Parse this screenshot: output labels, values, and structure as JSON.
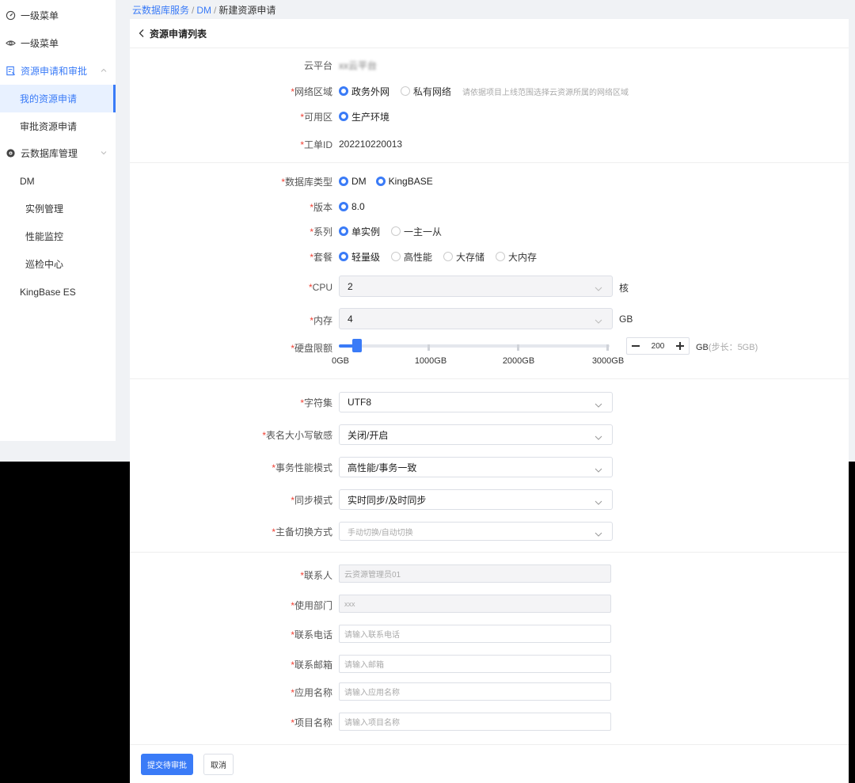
{
  "sidebar": {
    "items": [
      {
        "label": "一级菜单",
        "icon": "dashboard-icon"
      },
      {
        "label": "一级菜单",
        "icon": "eye-icon"
      },
      {
        "label": "资源申请和审批",
        "icon": "form-icon"
      },
      {
        "label": "我的资源申请"
      },
      {
        "label": "审批资源申请"
      },
      {
        "label": "云数据库管理",
        "icon": "database-icon"
      },
      {
        "label": "DM"
      },
      {
        "label": "实例管理"
      },
      {
        "label": "性能监控"
      },
      {
        "label": "巡检中心"
      },
      {
        "label": "KingBase ES"
      }
    ]
  },
  "breadcrumb": {
    "items": [
      "云数据库服务",
      "DM",
      "新建资源申请"
    ],
    "sep": "/"
  },
  "header": {
    "title": "资源申请列表"
  },
  "form": {
    "cloud_platform": {
      "label": "云平台",
      "value": "xx云平台"
    },
    "network": {
      "label": "网络区域",
      "options": [
        "政务外网",
        "私有网络"
      ],
      "selected": "政务外网",
      "hint": "请依据项目上线范围选择云资源所属的网络区域"
    },
    "zone": {
      "label": "可用区",
      "options": [
        "生产环境"
      ],
      "selected": "生产环境"
    },
    "ticket": {
      "label": "工单ID",
      "value": "202210220013"
    },
    "db_type": {
      "label": "数据库类型",
      "options": [
        "DM",
        "KingBASE"
      ],
      "selected": [
        "DM",
        "KingBASE"
      ]
    },
    "version": {
      "label": "版本",
      "options": [
        "8.0"
      ],
      "selected": "8.0"
    },
    "series": {
      "label": "系列",
      "options": [
        "单实例",
        "一主一从"
      ],
      "selected": "单实例"
    },
    "plan": {
      "label": "套餐",
      "options": [
        "轻量级",
        "高性能",
        "大存储",
        "大内存"
      ],
      "selected": "轻量级"
    },
    "cpu": {
      "label": "CPU",
      "value": "2",
      "unit": "核"
    },
    "memory": {
      "label": "内存",
      "value": "4",
      "unit": "GB"
    },
    "disk": {
      "label": "硬盘限额",
      "value": "200",
      "max": 3000,
      "ticks": [
        "0GB",
        "1000GB",
        "2000GB",
        "3000GB"
      ],
      "unit": "GB",
      "step_note": "(步长：5GB)"
    },
    "charset": {
      "label": "字符集",
      "value": "UTF8"
    },
    "case_sensitive": {
      "label": "表名大小写敏感",
      "value": "关闭/开启"
    },
    "txn_mode": {
      "label": "事务性能模式",
      "value": "高性能/事务一致"
    },
    "sync_mode": {
      "label": "同步模式",
      "value": "实时同步/及时同步"
    },
    "switch_mode": {
      "label": "主备切换方式",
      "placeholder": "手动切换/自动切换"
    },
    "contact": {
      "label": "联系人",
      "value": "云资源管理员01"
    },
    "department": {
      "label": "使用部门",
      "value": "xxx"
    },
    "phone": {
      "label": "联系电话",
      "placeholder": "请输入联系电话"
    },
    "email": {
      "label": "联系邮箱",
      "placeholder": "请输入邮箱"
    },
    "app_name": {
      "label": "应用名称",
      "placeholder": "请输入应用名称"
    },
    "project_name": {
      "label": "项目名称",
      "placeholder": "请输入项目名称"
    }
  },
  "footer": {
    "submit": "提交待审批",
    "cancel": "取消"
  },
  "colors": {
    "accent": "#3a7bf7",
    "required": "#f04134"
  }
}
